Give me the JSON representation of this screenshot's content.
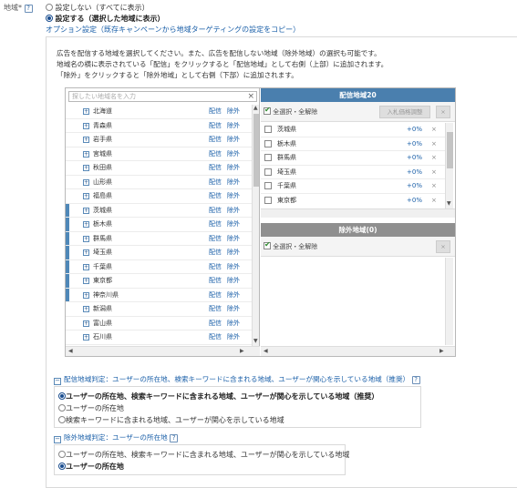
{
  "region_label": "地域",
  "required_mark": "*",
  "help_glyph": "?",
  "options": {
    "all_regions": "設定しない（すべてに表示）",
    "selected_regions": "設定する（選択した地域に表示）",
    "copy_link": "オプション設定（既存キャンペーンから地域ターゲティングの設定をコピー）"
  },
  "description": [
    "広告を配信する地域を選択してください。また、広告を配信しない地域（除外地域）の選択も可能です。",
    "地域名の横に表示されている「配信」をクリックすると「配信地域」として右側（上部）に追加されます。",
    "「除外」をクリックすると「除外地域」として右側（下部）に追加されます。"
  ],
  "search": {
    "placeholder": "探したい地域名を入力",
    "clear": "×"
  },
  "list_actions": {
    "deliver": "配信",
    "exclude": "除外",
    "expand": "+"
  },
  "prefectures": [
    {
      "name": "北海道",
      "selected": false
    },
    {
      "name": "青森県",
      "selected": false
    },
    {
      "name": "岩手県",
      "selected": false
    },
    {
      "name": "宮城県",
      "selected": false
    },
    {
      "name": "秋田県",
      "selected": false
    },
    {
      "name": "山形県",
      "selected": false
    },
    {
      "name": "福島県",
      "selected": false
    },
    {
      "name": "茨城県",
      "selected": true
    },
    {
      "name": "栃木県",
      "selected": true
    },
    {
      "name": "群馬県",
      "selected": true
    },
    {
      "name": "埼玉県",
      "selected": true
    },
    {
      "name": "千葉県",
      "selected": true
    },
    {
      "name": "東京都",
      "selected": true
    },
    {
      "name": "神奈川県",
      "selected": true
    },
    {
      "name": "新潟県",
      "selected": false
    },
    {
      "name": "富山県",
      "selected": false
    },
    {
      "name": "石川県",
      "selected": false
    }
  ],
  "delivery": {
    "header": "配信地域20",
    "select_all": "全選択・全解除",
    "bid_button": "入札価格調整",
    "remove_button": "×",
    "items": [
      {
        "name": "茨城県",
        "bid": "+0%"
      },
      {
        "name": "栃木県",
        "bid": "+0%"
      },
      {
        "name": "群馬県",
        "bid": "+0%"
      },
      {
        "name": "埼玉県",
        "bid": "+0%"
      },
      {
        "name": "千葉県",
        "bid": "+0%"
      },
      {
        "name": "東京都",
        "bid": "+0%"
      }
    ],
    "item_remove": "×"
  },
  "exclusion": {
    "header": "除外地域(0)",
    "select_all": "全選択・全解除",
    "remove_button": "×"
  },
  "delivery_judgement": {
    "title": "配信地域判定：ユーザーの所在地、検索キーワードに含まれる地域、ユーザーが関心を示している地域（推奨）",
    "collapse": "−",
    "options": [
      {
        "label": "ユーザーの所在地、検索キーワードに含まれる地域、ユーザーが関心を示している地域（推奨）",
        "checked": true
      },
      {
        "label": "ユーザーの所在地",
        "checked": false
      },
      {
        "label": "検索キーワードに含まれる地域、ユーザーが関心を示している地域",
        "checked": false
      }
    ]
  },
  "exclusion_judgement": {
    "title": "除外地域判定：ユーザーの所在地",
    "collapse": "−",
    "options": [
      {
        "label": "ユーザーの所在地、検索キーワードに含まれる地域、ユーザーが関心を示している地域",
        "checked": false
      },
      {
        "label": "ユーザーの所在地",
        "checked": true
      }
    ]
  },
  "colors": {
    "accent": "#4a7fae",
    "link": "#1a5fa8",
    "selected_bar": "#4f88b8",
    "exclusion_header": "#8f8f8f"
  }
}
